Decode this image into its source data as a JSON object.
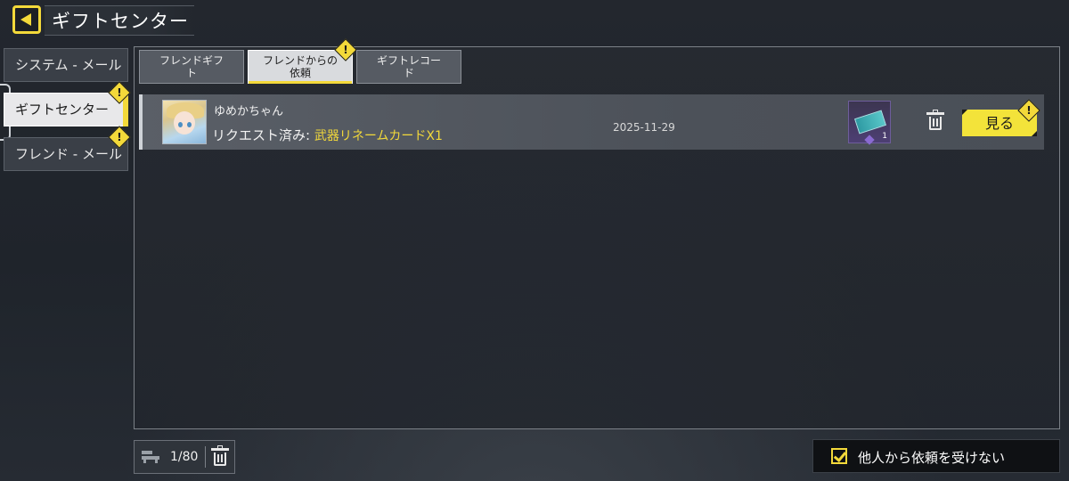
{
  "header": {
    "title": "ギフトセンター",
    "back_icon": "chevron-left-icon"
  },
  "sidebar": {
    "items": [
      {
        "label": "システム - メール",
        "active": false,
        "alert": false
      },
      {
        "label": "ギフトセンター",
        "active": true,
        "alert": true
      },
      {
        "label": "フレンド - メール",
        "active": false,
        "alert": true
      }
    ]
  },
  "tabs": [
    {
      "label": "フレンドギフト",
      "active": false,
      "alert": false
    },
    {
      "label": "フレンドからの依頼",
      "active": true,
      "alert": true
    },
    {
      "label": "ギフトレコード",
      "active": false,
      "alert": false
    }
  ],
  "requests": [
    {
      "friend_name": "ゆめかちゃん",
      "status_label": "リクエスト済み:",
      "item_name": "武器リネームカードX1",
      "date": "2025-11-29",
      "item_quantity": "1",
      "view_label": "見る"
    }
  ],
  "footer": {
    "capacity": "1/80",
    "decline_requests_label": "他人から依頼を受けない",
    "decline_requests_checked": true
  },
  "colors": {
    "accent": "#f3d93a",
    "button": "#f3e33a"
  }
}
